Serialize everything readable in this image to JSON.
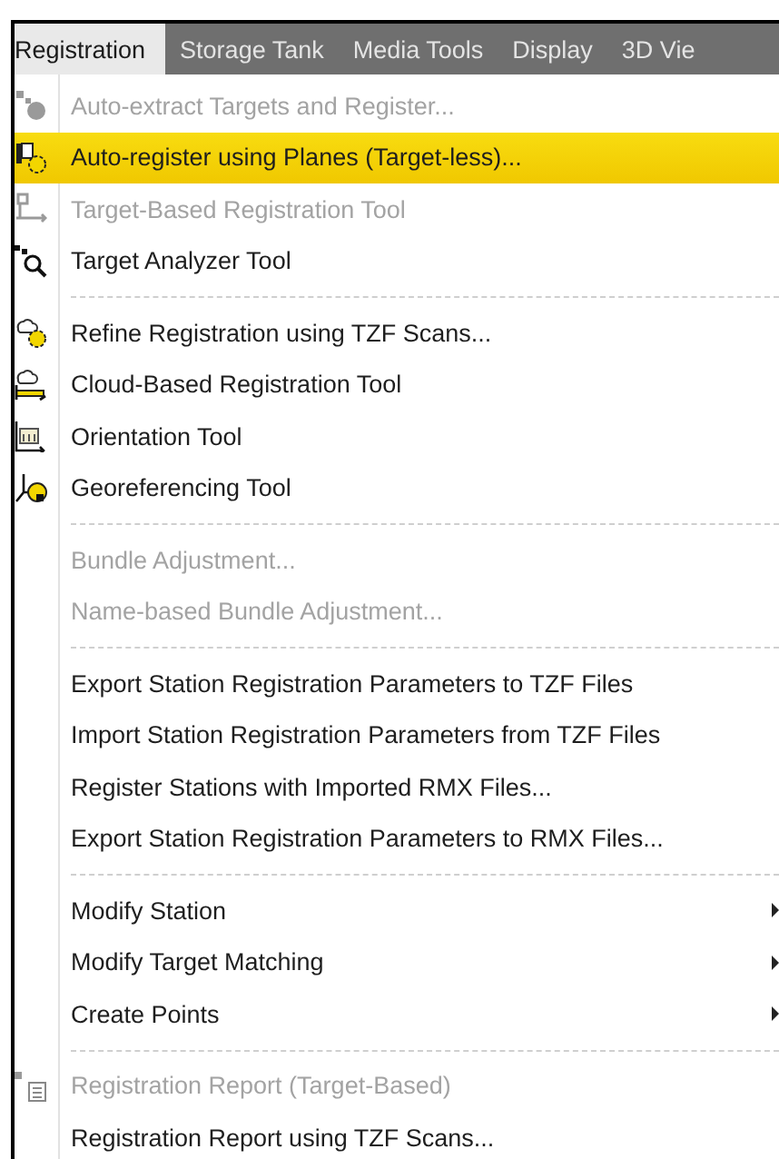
{
  "menu_bar": [
    {
      "label": "Registration",
      "selected": true
    },
    {
      "label": "Storage Tank",
      "selected": false
    },
    {
      "label": "Media Tools",
      "selected": false
    },
    {
      "label": "Display",
      "selected": false
    },
    {
      "label": "3D Vie",
      "selected": false
    }
  ],
  "menu": [
    {
      "kind": "item",
      "label": "Auto-extract Targets and Register...",
      "disabled": true,
      "selected": false,
      "submenu": false
    },
    {
      "kind": "item",
      "label": "Auto-register using Planes (Target-less)...",
      "disabled": false,
      "selected": true,
      "submenu": false
    },
    {
      "kind": "item",
      "label": "Target-Based Registration Tool",
      "disabled": true,
      "selected": false,
      "submenu": false
    },
    {
      "kind": "item",
      "label": "Target Analyzer Tool",
      "disabled": false,
      "selected": false,
      "submenu": false
    },
    {
      "kind": "separator"
    },
    {
      "kind": "item",
      "label": "Refine Registration using TZF Scans...",
      "disabled": false,
      "selected": false,
      "submenu": false
    },
    {
      "kind": "item",
      "label": "Cloud-Based Registration Tool",
      "disabled": false,
      "selected": false,
      "submenu": false
    },
    {
      "kind": "item",
      "label": "Orientation Tool",
      "disabled": false,
      "selected": false,
      "submenu": false
    },
    {
      "kind": "item",
      "label": "Georeferencing Tool",
      "disabled": false,
      "selected": false,
      "submenu": false
    },
    {
      "kind": "separator"
    },
    {
      "kind": "item",
      "label": "Bundle Adjustment...",
      "disabled": true,
      "selected": false,
      "submenu": false
    },
    {
      "kind": "item",
      "label": "Name-based Bundle Adjustment...",
      "disabled": true,
      "selected": false,
      "submenu": false
    },
    {
      "kind": "separator"
    },
    {
      "kind": "item",
      "label": "Export Station Registration Parameters to TZF Files",
      "disabled": false,
      "selected": false,
      "submenu": false
    },
    {
      "kind": "item",
      "label": "Import Station Registration Parameters from TZF Files",
      "disabled": false,
      "selected": false,
      "submenu": false
    },
    {
      "kind": "item",
      "label": "Register Stations with Imported RMX Files...",
      "disabled": false,
      "selected": false,
      "submenu": false
    },
    {
      "kind": "item",
      "label": "Export Station Registration Parameters to RMX Files...",
      "disabled": false,
      "selected": false,
      "submenu": false
    },
    {
      "kind": "separator"
    },
    {
      "kind": "item",
      "label": "Modify Station",
      "disabled": false,
      "selected": false,
      "submenu": true
    },
    {
      "kind": "item",
      "label": "Modify Target Matching",
      "disabled": false,
      "selected": false,
      "submenu": true
    },
    {
      "kind": "item",
      "label": "Create Points",
      "disabled": false,
      "selected": false,
      "submenu": true
    },
    {
      "kind": "separator"
    },
    {
      "kind": "item",
      "label": "Registration Report (Target-Based)",
      "disabled": true,
      "selected": false,
      "submenu": false
    },
    {
      "kind": "item",
      "label": "Registration Report using TZF Scans...",
      "disabled": false,
      "selected": false,
      "submenu": false
    }
  ]
}
